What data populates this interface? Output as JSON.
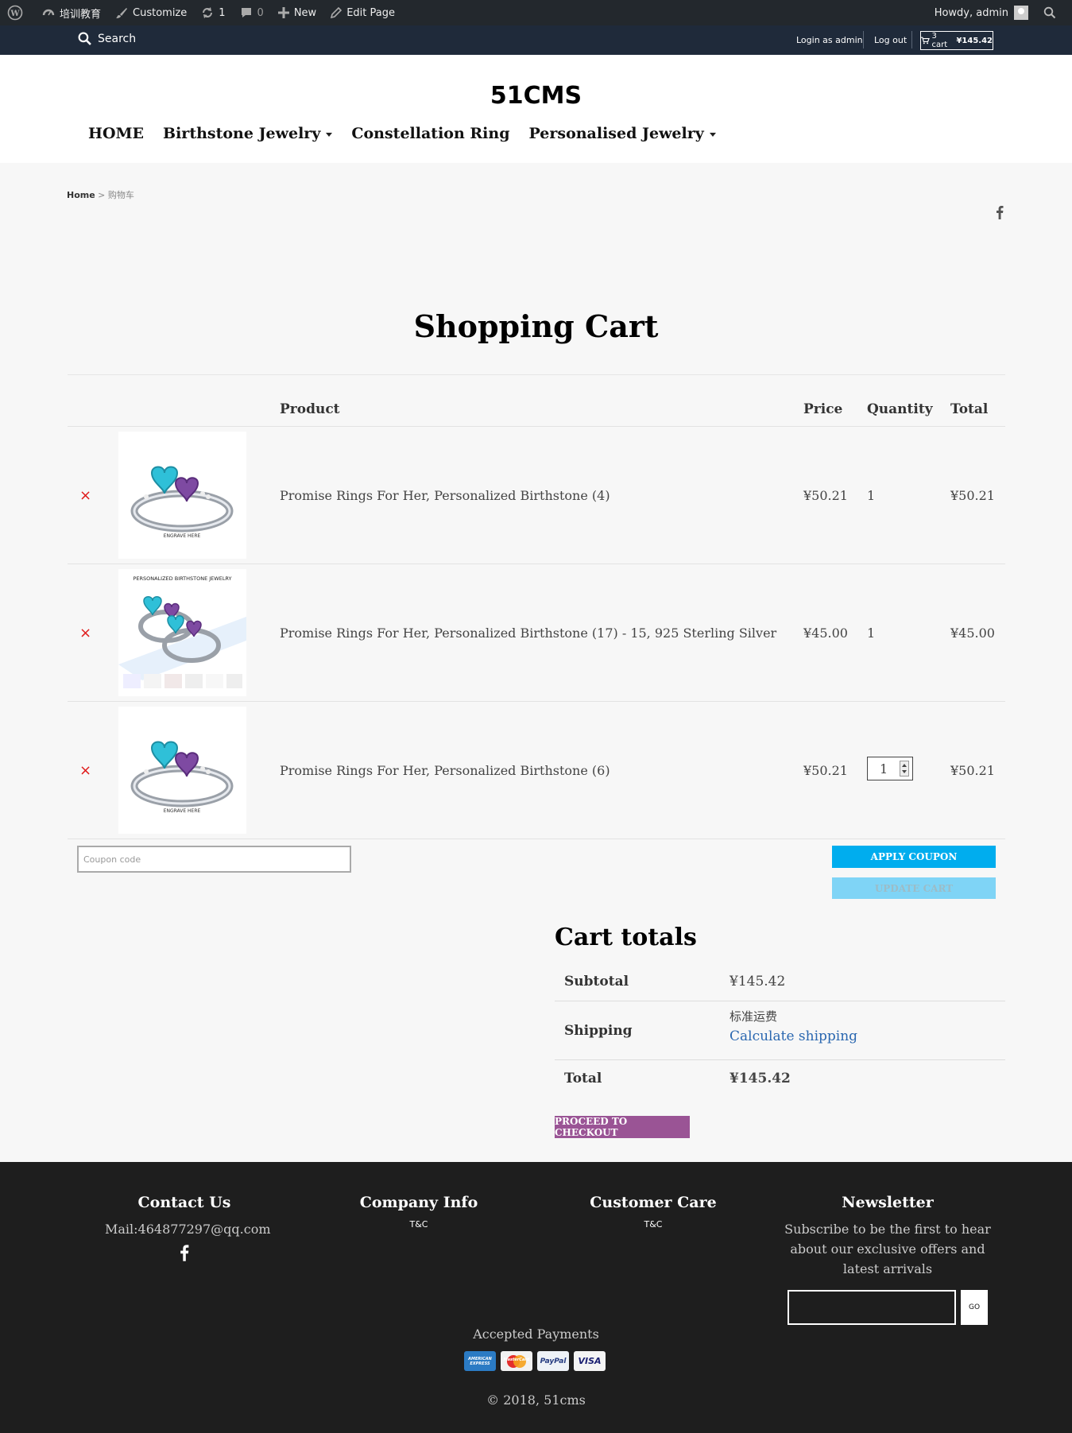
{
  "adminbar": {
    "site_name": "培训教育",
    "customize": "Customize",
    "updates_count": "1",
    "comments_count": "0",
    "new_label": "New",
    "edit_page": "Edit Page",
    "howdy": "Howdy, admin"
  },
  "topbar": {
    "search": "Search",
    "login": "Login as admin",
    "logout": "Log out",
    "cart_count": "3 cart",
    "cart_total": "¥145.42"
  },
  "header": {
    "site_title": "51CMS",
    "nav": [
      {
        "label": "HOME",
        "dropdown": false
      },
      {
        "label": "Birthstone Jewelry",
        "dropdown": true
      },
      {
        "label": "Constellation Ring",
        "dropdown": false
      },
      {
        "label": "Personalised Jewelry",
        "dropdown": true
      }
    ]
  },
  "breadcrumb": {
    "home": "Home",
    "separator": " > ",
    "current": "购物车"
  },
  "page_title": "Shopping Cart",
  "cart": {
    "headers": {
      "product": "Product",
      "price": "Price",
      "quantity": "Quantity",
      "total": "Total"
    },
    "remove_symbol": "×",
    "items": [
      {
        "name": "Promise Rings For Her, Personalized Birthstone (4)",
        "price": "¥50.21",
        "quantity": "1",
        "total": "¥50.21",
        "thumb_caption": ""
      },
      {
        "name": "Promise Rings For Her, Personalized Birthstone (17) - 15, 925 Sterling Silver",
        "price": "¥45.00",
        "quantity": "1",
        "total": "¥45.00",
        "thumb_caption": "PERSONALIZED BIRTHSTONE JEWELRY"
      },
      {
        "name": "Promise Rings For Her, Personalized Birthstone (6)",
        "price": "¥50.21",
        "quantity": "1",
        "total": "¥50.21",
        "thumb_caption": ""
      }
    ],
    "coupon_placeholder": "Coupon code",
    "apply_coupon": "APPLY COUPON",
    "update_cart": "UPDATE CART"
  },
  "totals": {
    "heading": "Cart totals",
    "subtotal_label": "Subtotal",
    "subtotal": "¥145.42",
    "shipping_label": "Shipping",
    "shipping_method": "标准运费",
    "calculate_shipping": "Calculate shipping",
    "total_label": "Total",
    "total": "¥145.42",
    "checkout": "PROCEED TO CHECKOUT"
  },
  "footer": {
    "contact_heading": "Contact Us",
    "contact_mail": "Mail:464877297@qq.com",
    "company_heading": "Company Info",
    "company_link": "T&C",
    "care_heading": "Customer Care",
    "care_link": "T&C",
    "newsletter_heading": "Newsletter",
    "newsletter_text_1": "Subscribe to be the first to hear",
    "newsletter_text_2": "about our exclusive offers and",
    "newsletter_text_3": "latest arrivals",
    "go": "GO",
    "accepted": "Accepted Payments",
    "cards": [
      "AMERICAN EXPRESS",
      "MasterCard",
      "PayPal",
      "VISA"
    ],
    "copyright": "© 2018, 51cms"
  },
  "colors": {
    "adminbar": "#23282d",
    "topbar": "#1f2a3a",
    "apply_button": "#00adee",
    "update_button": "#7fd4f6",
    "checkout_button": "#9a5495",
    "remove": "#e01b1b",
    "link": "#2a67b0",
    "footer": "#1e1e1e"
  }
}
